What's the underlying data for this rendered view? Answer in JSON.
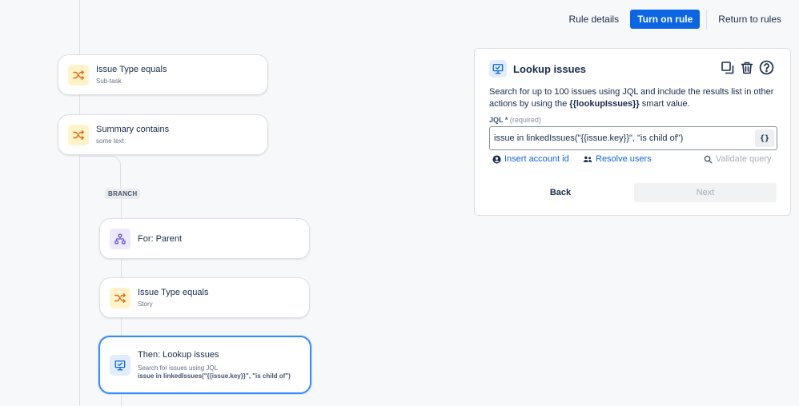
{
  "topbar": {
    "rule_details": "Rule details",
    "turn_on": "Turn on rule",
    "return": "Return to rules"
  },
  "flow": {
    "branch_label": "BRANCH",
    "cards": [
      {
        "title": "Issue Type equals",
        "subtitle": "Sub-task",
        "icon": "shuffle-icon"
      },
      {
        "title": "Summary contains",
        "subtitle": "some text",
        "icon": "shuffle-icon"
      },
      {
        "title": "For: Parent",
        "subtitle": "",
        "icon": "hierarchy-icon"
      },
      {
        "title": "Issue Type equals",
        "subtitle": "Story",
        "icon": "shuffle-icon"
      },
      {
        "title": "Then: Lookup issues",
        "subtitle": "Search for issues using JQL",
        "detail": "issue in linkedIssues(\"{{issue.key}}\", \"is child of\")",
        "icon": "monitor-icon"
      }
    ]
  },
  "panel": {
    "title": "Lookup issues",
    "desc_pre": "Search for up to 100 issues using JQL and include the results list in other actions by using the ",
    "desc_bold": "{{lookupIssues}}",
    "desc_post": " smart value.",
    "jql_label": "JQL",
    "jql_star": "*",
    "jql_required": "(required)",
    "jql_value": "issue in linkedIssues(\"{{issue.key}}\", \"is child of\")",
    "smart_btn": "{}",
    "insert_account": "Insert account id",
    "resolve_users": "Resolve users",
    "validate": "Validate query",
    "back": "Back",
    "next": "Next"
  },
  "colors": {
    "primary": "#0c66e4",
    "selected_border": "#388bff",
    "condition_icon": "#e56910",
    "branch_icon": "#6e5dc6",
    "action_icon": "#0c66e4"
  }
}
